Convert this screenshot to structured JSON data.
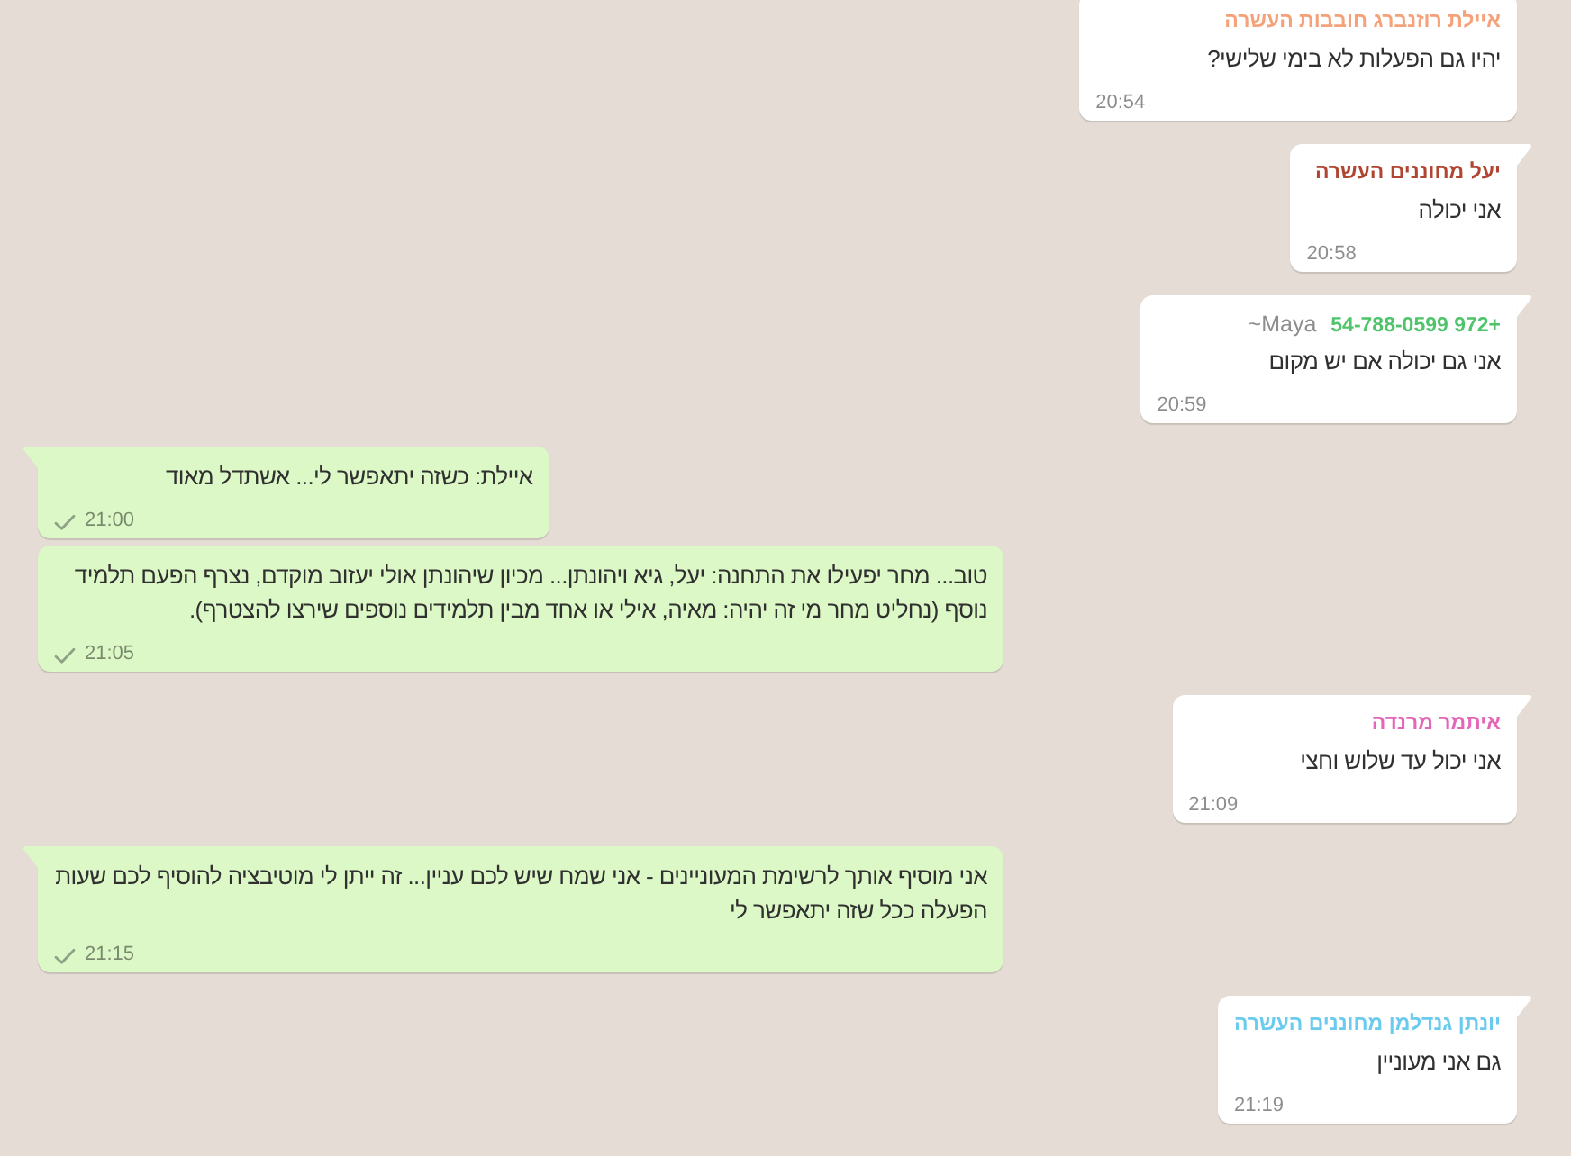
{
  "messages": [
    {
      "kind": "incoming",
      "tail": false,
      "sender": {
        "name": "איילת רוזנברג חובבות העשרה",
        "color": "#f5a27a"
      },
      "text": "יהיו גם הפעלות לא בימי שלישי?",
      "time": "20:54"
    },
    {
      "kind": "incoming",
      "tail": true,
      "sender": {
        "name": "יעל מחוננים העשרה",
        "color": "#b04632"
      },
      "text": "אני יכולה",
      "time": "20:58"
    },
    {
      "kind": "incoming",
      "tail": true,
      "sender": {
        "name": "+972 54-788-0599",
        "color": "#4fc46b",
        "push_name": "~Maya"
      },
      "text": "אני גם יכולה אם יש מקום",
      "time": "20:59"
    },
    {
      "kind": "outgoing",
      "tail": true,
      "sent": true,
      "text": "איילת: כשזה יתאפשר לי... אשתדל מאוד",
      "time": "21:00"
    },
    {
      "kind": "outgoing",
      "tail": false,
      "sent": true,
      "text": "טוב... מחר יפעילו את התחנה: יעל, גיא ויהונתן... מכיון שיהונתן אולי יעזוב מוקדם, נצרף הפעם תלמיד נוסף (נחליט מחר מי זה יהיה: מאיה, אילי או אחד מבין תלמידים נוספים שירצו להצטרף).",
      "time": "21:05"
    },
    {
      "kind": "incoming",
      "tail": true,
      "sender": {
        "name": "איתמר מרנדה",
        "color": "#e366b8"
      },
      "text": "אני יכול עד שלוש וחצי",
      "time": "21:09"
    },
    {
      "kind": "outgoing",
      "tail": true,
      "sent": true,
      "text": "אני מוסיף אותך לרשימת המעוניינים - אני שמח שיש לכם עניין... זה ייתן לי מוטיבציה להוסיף לכם שעות הפעלה ככל שזה יתאפשר לי",
      "time": "21:15"
    },
    {
      "kind": "incoming",
      "tail": true,
      "sender": {
        "name": "יונתן גנדלמן מחוננים העשרה",
        "color": "#6bcbef"
      },
      "text": "גם אני מעוניין",
      "time": "21:19"
    }
  ]
}
